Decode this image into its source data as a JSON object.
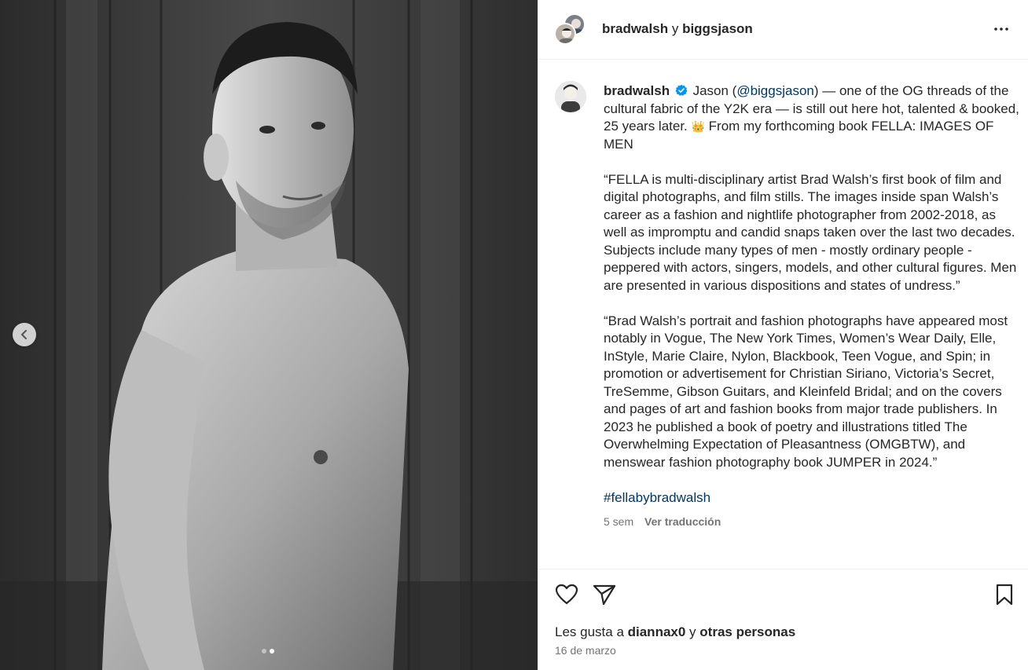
{
  "header": {
    "user1": "bradwalsh",
    "separator": "y",
    "user2": "biggsjason"
  },
  "media": {
    "carousel_total": 2,
    "carousel_active": 2
  },
  "caption": {
    "username": "bradwalsh",
    "text_part1": "Jason (",
    "mention": "@biggsjason",
    "text_part2": ") — one of the OG threads of the cultural fabric of the Y2K era — is still out here hot, talented & booked, 25 years later. ",
    "emoji": "👑",
    "text_part3": " From my forthcoming book FELLA: IMAGES OF MEN",
    "paragraph2": "“FELLA is multi-disciplinary artist Brad Walsh’s first book of film and digital photographs, and film stills. The images inside span Walsh’s career as a fashion and nightlife photographer from 2002-2018, as well as impromptu and candid snaps taken over the last two decades. Subjects include many types of men - mostly ordinary people - peppered with actors, singers, models, and other cultural figures. Men are presented in various dispositions and states of undress.”",
    "paragraph3": "“Brad Walsh’s portrait and fashion photographs have appeared most notably in Vogue, The New York Times, Women’s Wear Daily, Elle, InStyle, Marie Claire, Nylon, Blackbook, Teen Vogue, and Spin; in promotion or advertisement for Christian Siriano, Victoria’s Secret, TreSemme, Gibson Guitars, and Kleinfeld Bridal; and on the covers and pages of art and fashion books from major trade publishers. In 2023 he published a book of poetry and illustrations titled The Overwhelming Expectation of Pleasantness (OMGBTW), and menswear fashion photography book JUMPER in 2024.”",
    "hashtag": "#fellabybradwalsh",
    "age": "5 sem",
    "translate": "Ver traducción"
  },
  "likes": {
    "prefix": "Les gusta a ",
    "user": "diannax0",
    "middle": " y ",
    "others": "otras personas"
  },
  "date": "16 de marzo",
  "colors": {
    "link": "#00376b",
    "verified": "#0095f6",
    "muted": "#737373"
  }
}
